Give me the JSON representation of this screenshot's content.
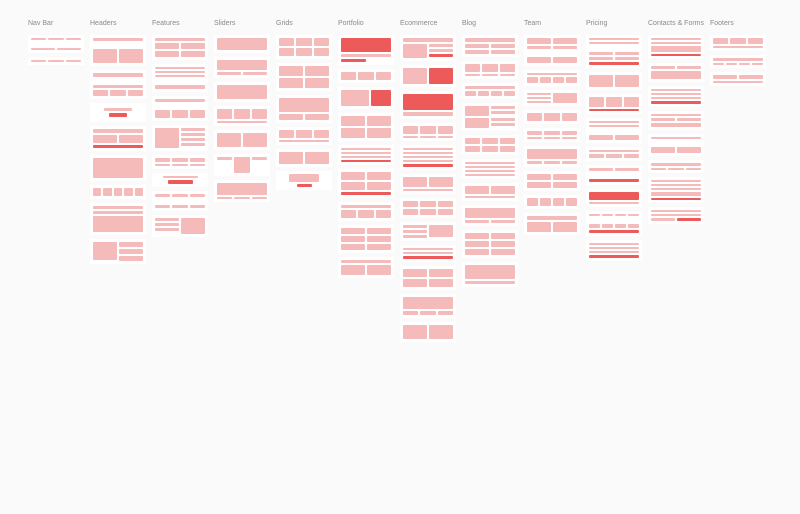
{
  "categories": [
    {
      "id": "navbar",
      "label": "Nav Bar"
    },
    {
      "id": "headers",
      "label": "Headers"
    },
    {
      "id": "features",
      "label": "Features"
    },
    {
      "id": "sliders",
      "label": "Sliders"
    },
    {
      "id": "grids",
      "label": "Grids"
    },
    {
      "id": "portfolio",
      "label": "Portfolio"
    },
    {
      "id": "ecommerce",
      "label": "Ecommerce"
    },
    {
      "id": "blog",
      "label": "Blog"
    },
    {
      "id": "team",
      "label": "Team"
    },
    {
      "id": "pricing",
      "label": "Pricing"
    },
    {
      "id": "contacts",
      "label": "Contacts & Forms"
    },
    {
      "id": "footers",
      "label": "Footers"
    }
  ],
  "colors": {
    "light": "#f5baba",
    "accent": "#ed5a5a",
    "bg": "#ffffff"
  }
}
